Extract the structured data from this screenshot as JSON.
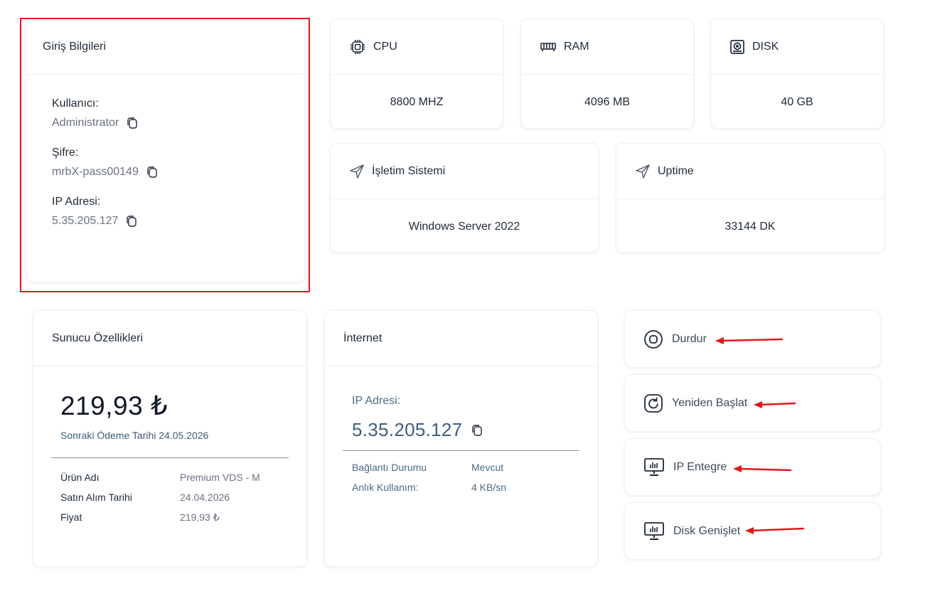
{
  "login": {
    "title": "Giriş Bilgileri",
    "user_label": "Kullanıcı:",
    "user_value": "Administrator",
    "password_label": "Şifre:",
    "password_value": "mrbX-pass00149",
    "ip_label": "IP Adresi:",
    "ip_value": "5.35.205.127"
  },
  "stats": {
    "cpu": {
      "label": "CPU",
      "value": "8800 MHZ"
    },
    "ram": {
      "label": "RAM",
      "value": "4096 MB"
    },
    "disk": {
      "label": "DISK",
      "value": "40 GB"
    },
    "os": {
      "label": "İşletim Sistemi",
      "value": "Windows Server 2022"
    },
    "uptime": {
      "label": "Uptime",
      "value": "33144 DK"
    }
  },
  "server": {
    "title": "Sunucu Özellikleri",
    "price": "219,93 ₺",
    "next_payment": "Sonraki Ödeme Tarihi 24.05.2026",
    "rows": [
      {
        "key": "Ürün Adı",
        "value": "Premium VDS - M"
      },
      {
        "key": "Satın Alım Tarihi",
        "value": "24.04.2026"
      },
      {
        "key": "Fiyat",
        "value": "219,93 ₺"
      }
    ]
  },
  "internet": {
    "title": "İnternet",
    "ip_label": "IP Adresi:",
    "ip_value": "5.35.205.127",
    "rows": [
      {
        "key": "Bağlantı Durumu",
        "value": "Mevcut"
      },
      {
        "key": "Anlık Kullanım:",
        "value": "4 KB/sn"
      }
    ]
  },
  "actions": {
    "stop": "Durdur",
    "restart": "Yeniden Başlat",
    "ip_integrate": "IP Entegre",
    "disk_expand": "Disk Genişlet"
  },
  "colors": {
    "highlight": "#e3171b",
    "arrow": "#e3171b",
    "muted_text": "#6b7280",
    "link_blue": "#3f5f80"
  },
  "icons": {
    "cpu": "cpu-chip-icon",
    "ram": "memory-icon",
    "disk": "hard-disk-icon",
    "os": "send-plane-icon",
    "uptime": "send-plane-icon",
    "copy": "copy-icon",
    "stop": "stop-circle-icon",
    "restart": "restart-icon",
    "ip_integrate": "monitor-chart-icon",
    "disk_expand": "monitor-chart-icon"
  }
}
